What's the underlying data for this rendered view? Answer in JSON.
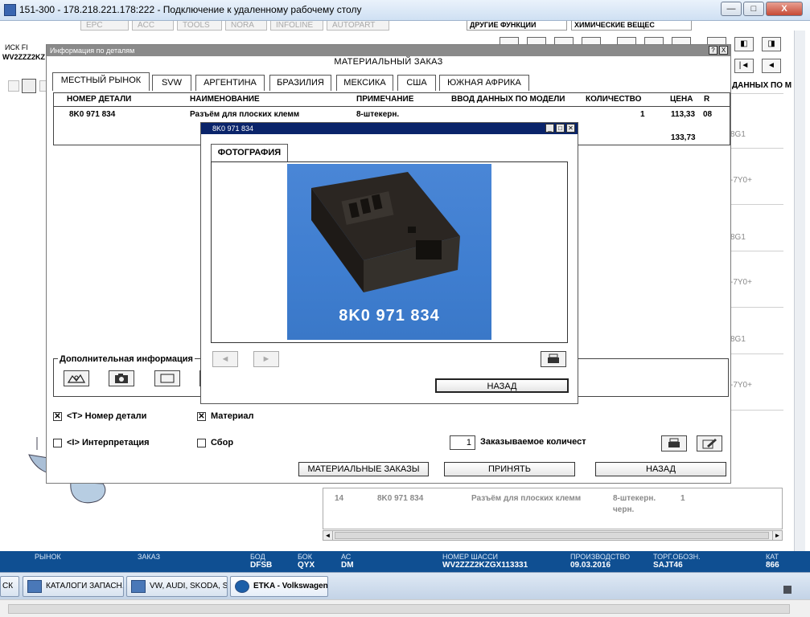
{
  "rdp": {
    "title": "151-300 - 178.218.221.178:222 - Подключение к удаленному рабочему столу",
    "minimize": "—",
    "maximize": "□",
    "close": "X"
  },
  "background": {
    "tabs": [
      "EPC",
      "ACC",
      "TOOLS",
      "NORA",
      "INFOLINE",
      "AUTOPART"
    ],
    "right_top_1": "ДРУГИЕ ФУНКЦИИ",
    "right_top_2": "ХИМИЧЕСКИЕ ВЕЩЕС",
    "left_label_1": "ИСК FI",
    "left_label_2": "WV2ZZZ2KZ",
    "right_col_header": "ДАННЫХ ПО М",
    "right_col_items": [
      "8G1",
      "-7Y0+",
      "8G1",
      "-7Y0+",
      "8G1",
      "-7Y0+"
    ],
    "lower_row": {
      "num": "14",
      "part": "8K0 971 834",
      "name": "Разъём для плоских клемм",
      "note": "8-штекерн.",
      "note2": "черн.",
      "qty": "1"
    }
  },
  "status_bar": {
    "items": [
      {
        "label": "РЫНОК",
        "value": ""
      },
      {
        "label": "ЗАКАЗ",
        "value": ""
      },
      {
        "label": "БОД",
        "value": "DFSB"
      },
      {
        "label": "БОК",
        "value": "QYX"
      },
      {
        "label": "АС",
        "value": "DM"
      },
      {
        "label": "НОМЕР ШАССИ",
        "value": "WV2ZZZ2KZGX113331"
      },
      {
        "label": "ПРОИЗВОДСТВО",
        "value": "09.03.2016"
      },
      {
        "label": "ТОРГ.ОБОЗН.",
        "value": "SAJT46"
      },
      {
        "label": "КАТ",
        "value": "866"
      }
    ]
  },
  "taskbar": {
    "start_stub": "СК",
    "tasks": [
      "КАТАЛОГИ ЗАПАСН...",
      "VW, AUDI, SKODA, S...",
      "ETKA - Volkswagen"
    ]
  },
  "main_dialog": {
    "title": "Информация по деталям",
    "help": "?",
    "close": "X",
    "heading": "МАТЕРИАЛЬНЫЙ ЗАКАЗ",
    "tabs": [
      "МЕСТНЫЙ РЫНОК",
      "SVW",
      "АРГЕНТИНА",
      "БРАЗИЛИЯ",
      "МЕКСИКА",
      "США",
      "ЮЖНАЯ АФРИКА"
    ],
    "columns": [
      "НОМЕР ДЕТАЛИ",
      "НАИМЕНОВАНИЕ",
      "ПРИМЕЧАНИЕ",
      "ВВОД ДАННЫХ ПО МОДЕЛИ",
      "КОЛИЧЕСТВО",
      "ЦЕНА",
      "R"
    ],
    "row": {
      "part_no": "8K0 971 834",
      "name": "Разъём для плоских клемм",
      "note": "8-штекерн.",
      "model_data": "",
      "qty": "1",
      "price": "113,33",
      "r": "08"
    },
    "total": "133,73",
    "additional_info": "Дополнительная информация",
    "checks": {
      "part_number": {
        "label": "<T> Номер детали",
        "checked": true
      },
      "material": {
        "label": "Материал",
        "checked": true
      },
      "interpretation": {
        "label": "<I> Интерпретация",
        "checked": false
      },
      "assembly": {
        "label": "Сбор",
        "checked": false
      }
    },
    "order_qty_value": "1",
    "order_qty_label": "Заказываемое количест",
    "buttons": {
      "material_orders": "МАТЕРИАЛЬНЫЕ ЗАКАЗЫ",
      "accept": "ПРИНЯТЬ",
      "back": "НАЗАД"
    }
  },
  "photo_dialog": {
    "title": "8K0 971 834",
    "tab": "ФОТОГРАФИЯ",
    "photo_caption": "8K0 971 834",
    "back_button": "НАЗАД",
    "prev": "◄",
    "next": "►"
  },
  "colors": {
    "status_bar_bg": "#0f4f92",
    "photo_title_bg": "#0a246a",
    "photo_bg": "#3f7ed0"
  }
}
